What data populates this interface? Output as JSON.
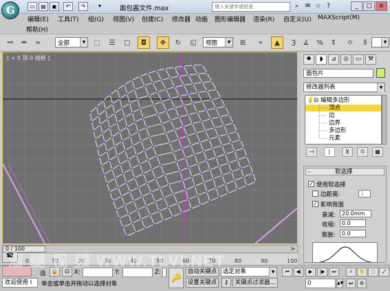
{
  "titlebar": {
    "title": "面包酱文件.max",
    "search_placeholder": "键入关键字或短语",
    "help_icon": "?",
    "min": "_",
    "max": "□",
    "close": "×"
  },
  "menu": {
    "items": [
      "编辑(E)",
      "工具(T)",
      "组(G)",
      "视图(V)",
      "创建(C)",
      "修改器",
      "动画",
      "图形编辑器",
      "渲染(R)",
      "自定义(U)",
      "MAXScript(M)"
    ],
    "second_row": "帮助(H)"
  },
  "toolbar": {
    "selection_filter": "全部",
    "ref_coord": "视图",
    "count_label": "3"
  },
  "viewport": {
    "label": "[ + 0 顶 0 线框 ]",
    "mesh_color": "#e8e8e8",
    "vertex_color": "#3a3aff",
    "axis_color": "#d62bd6"
  },
  "command_panel": {
    "object_name": "面包片",
    "object_color": "#c9f06b",
    "modifier_list": "修改器列表",
    "stack": [
      {
        "label": "编辑多边形",
        "level": 0,
        "selected": false
      },
      {
        "label": "顶点",
        "level": 1,
        "selected": true
      },
      {
        "label": "边",
        "level": 1,
        "selected": false
      },
      {
        "label": "边界",
        "level": 1,
        "selected": false
      },
      {
        "label": "多边形",
        "level": 1,
        "selected": false
      },
      {
        "label": "元素",
        "level": 1,
        "selected": false
      }
    ],
    "soft_selection": {
      "title": "软选择",
      "use_soft": "使用软选择",
      "edge_distance": "边距离:",
      "edge_distance_value": "1",
      "affect_backfacing": "影响背面",
      "falloff_label": "衰减:",
      "falloff_value": "20.0mm",
      "pinch_label": "收缩:",
      "pinch_value": "0.0",
      "bubble_label": "膨胀:",
      "bubble_value": "0.0"
    }
  },
  "timeslider": {
    "frame": "0 / 100",
    "ticks": [
      "0",
      "10",
      "20",
      "30",
      "40",
      "50",
      "60",
      "70",
      "80",
      "90",
      "100"
    ]
  },
  "status": {
    "welcome": "欢迎使用 I",
    "select_label": "选",
    "x_label": "X:",
    "y_label": "Y:",
    "z_label": "Z:",
    "auto_key": "自动关键点",
    "selected_object": "选定对象",
    "set_key": "设置关键点",
    "key_filters": "关键点过滤器...",
    "prompt": "单击或单击并拖动以选择对象",
    "frame_field": "0"
  },
  "watermark": "溜 腿 视 頻  WWW.TLVI.NET"
}
